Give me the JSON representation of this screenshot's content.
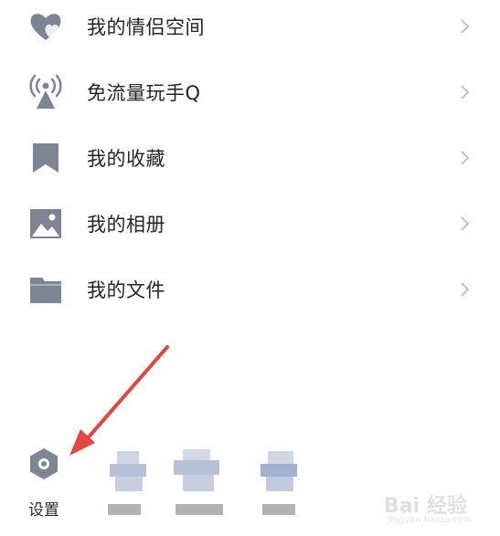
{
  "menu": {
    "items": [
      {
        "label": "我的情侣空间",
        "icon": "couple-heart-icon"
      },
      {
        "label": "免流量玩手Q",
        "icon": "signal-tower-icon"
      },
      {
        "label": "我的收藏",
        "icon": "bookmark-icon"
      },
      {
        "label": "我的相册",
        "icon": "photo-album-icon"
      },
      {
        "label": "我的文件",
        "icon": "folder-icon"
      }
    ],
    "chevron_icon": "chevron-right-icon"
  },
  "bottom": {
    "settings_label": "设置",
    "settings_icon": "gear-icon"
  },
  "annotation": {
    "arrow_color": "#e0473f"
  },
  "watermark": {
    "text": "Bai 经验",
    "sub": "jingyan.baidu.com"
  },
  "colors": {
    "icon": "#7d8594",
    "text": "#222428",
    "chevron": "#b9bcc2"
  }
}
